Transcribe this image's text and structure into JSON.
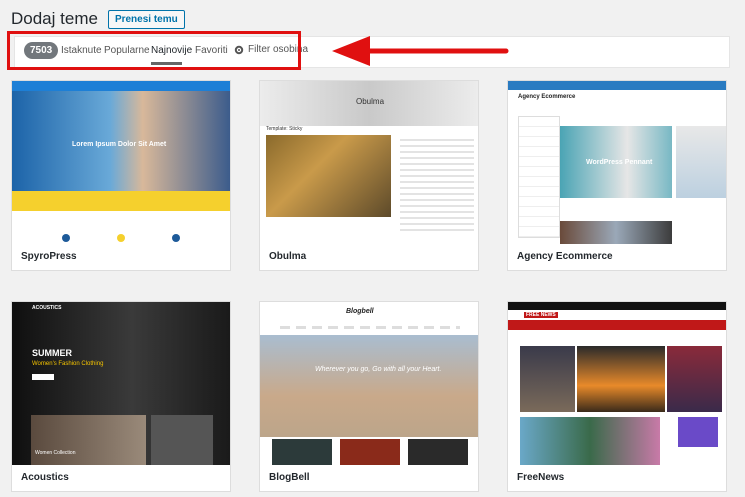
{
  "header": {
    "title": "Dodaj teme",
    "upload_label": "Prenesi temu"
  },
  "filter": {
    "count": "7503",
    "tabs": [
      "Istaknute",
      "Popularne",
      "Najnovije",
      "Favoriti"
    ],
    "active_tab": "Najnovije",
    "feature_filter": "Filter osobina"
  },
  "themes": [
    {
      "name": "SpyroPress",
      "hero_text": "Lorem Ipsum Dolor Sit Amet"
    },
    {
      "name": "Obulma",
      "hero_text": "Obulma",
      "sub_text": "Template: Sticky"
    },
    {
      "name": "Agency Ecommerce",
      "hero_text": "WordPress Pennant",
      "logo_text": "Agency Ecommerce"
    },
    {
      "name": "Acoustics",
      "logo_text": "ACOUSTICS",
      "hero_title": "SUMMER",
      "hero_sub": "Women's Fashion Clothing",
      "promo": "Women Collection"
    },
    {
      "name": "BlogBell",
      "logo_text": "Blogbell",
      "hero_text": "Wherever you go, Go with all your Heart."
    },
    {
      "name": "FreeNews",
      "logo_text": "FREE NEWS"
    }
  ],
  "colors": {
    "highlight": "#e01010",
    "accent": "#0073aa"
  }
}
